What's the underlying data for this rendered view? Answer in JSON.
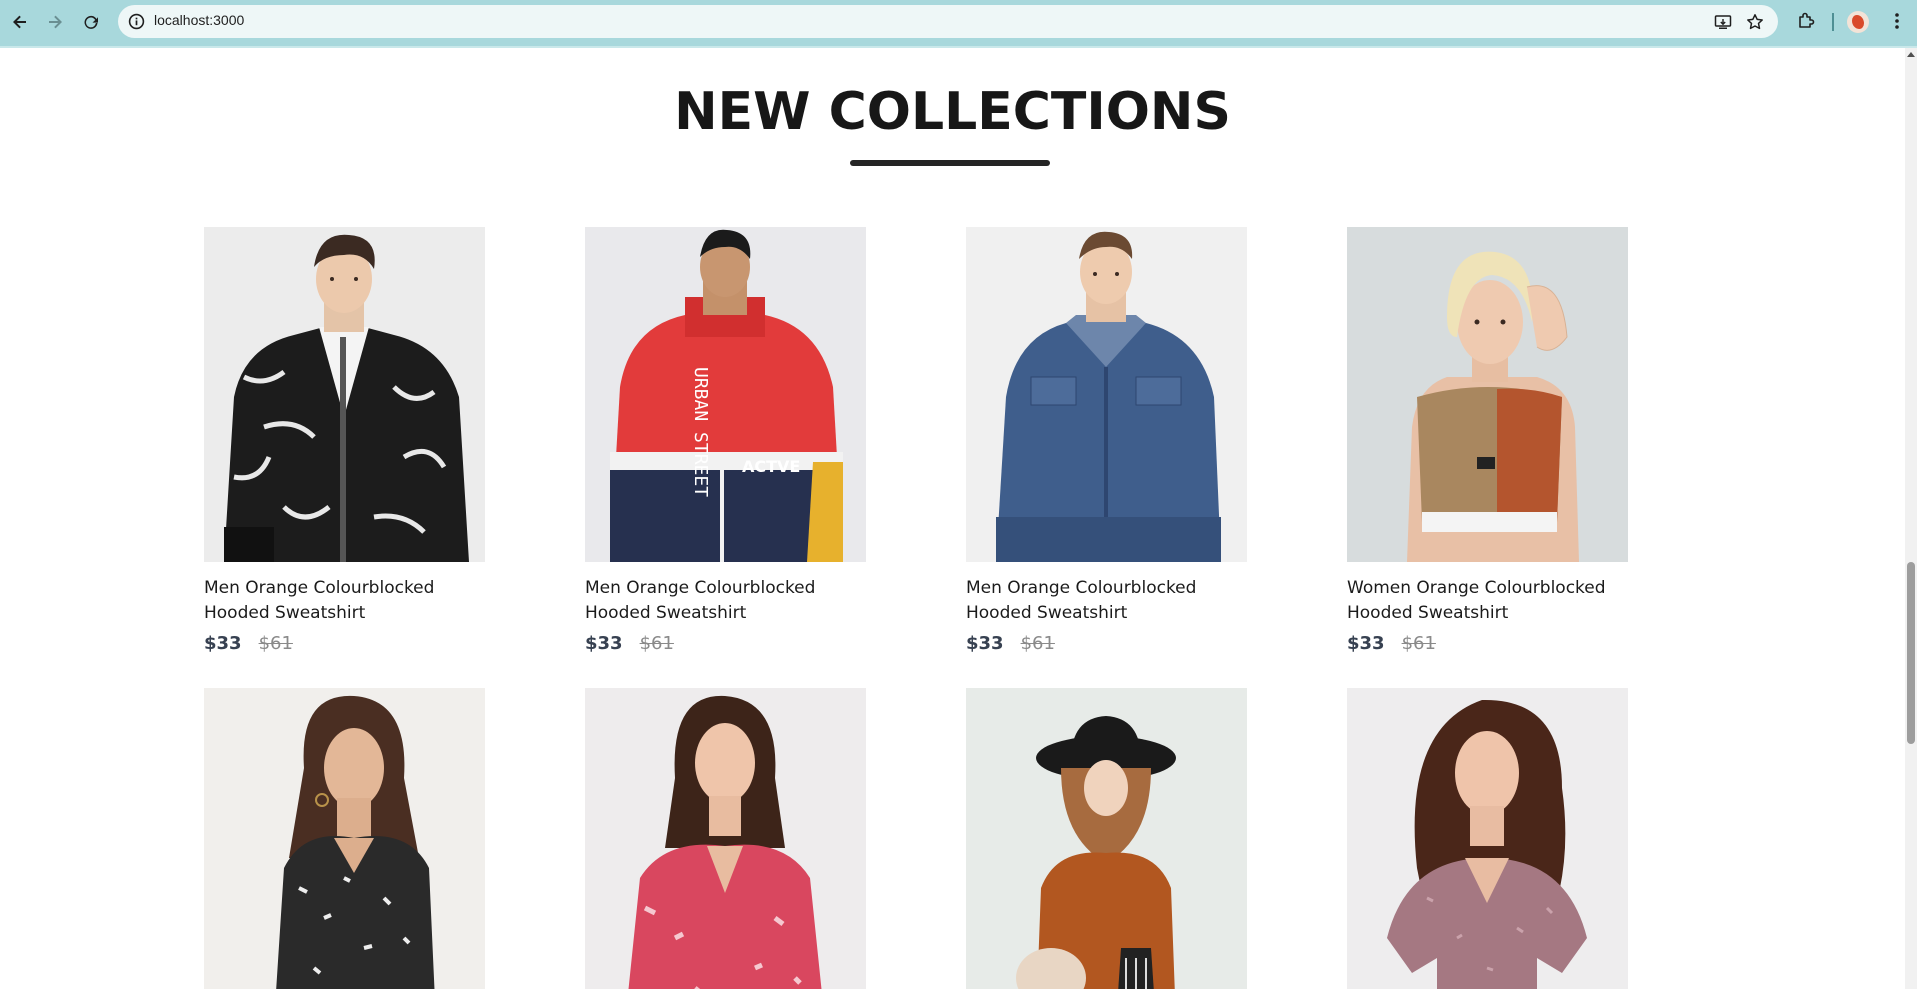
{
  "browser": {
    "url": "localhost:3000",
    "back_icon": "back-arrow-icon",
    "forward_icon": "forward-arrow-icon",
    "reload_icon": "reload-icon"
  },
  "section": {
    "title": "NEW COLLECTIONS"
  },
  "products": [
    {
      "name": "Men Orange Colourblocked Hooded Sweatshirt",
      "new_price": "$33",
      "old_price": "$61"
    },
    {
      "name": "Men Orange Colourblocked Hooded Sweatshirt",
      "new_price": "$33",
      "old_price": "$61"
    },
    {
      "name": "Men Orange Colourblocked Hooded Sweatshirt",
      "new_price": "$33",
      "old_price": "$61"
    },
    {
      "name": "Women Orange Colourblocked Hooded Sweatshirt",
      "new_price": "$33",
      "old_price": "$61"
    },
    {
      "name": "",
      "new_price": "",
      "old_price": ""
    },
    {
      "name": "",
      "new_price": "",
      "old_price": ""
    },
    {
      "name": "",
      "new_price": "",
      "old_price": ""
    },
    {
      "name": "",
      "new_price": "",
      "old_price": ""
    }
  ],
  "colors": {
    "chrome": "#a8d8dc",
    "new_price": "#374151",
    "old_price": "#8a8a8a",
    "title": "#171717"
  }
}
